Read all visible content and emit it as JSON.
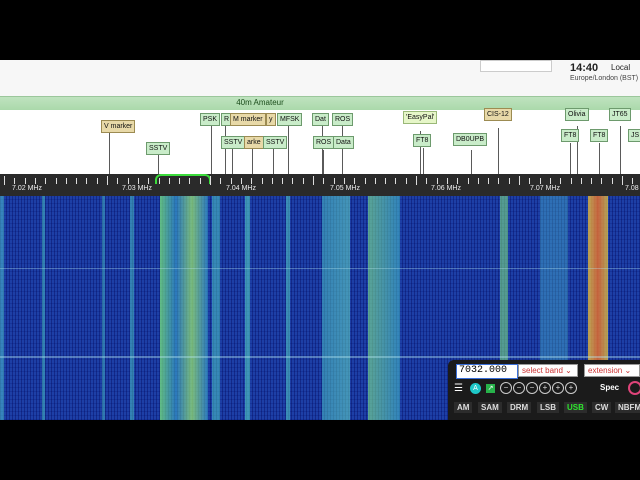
{
  "header": {
    "time": "14:40",
    "time_zone_label": "Local",
    "time_zone": "Europe/London (BST)"
  },
  "band": {
    "name": "40m Amateur"
  },
  "markers": [
    {
      "label": "V marker",
      "style": "tan"
    },
    {
      "label": "SSTV",
      "style": "green"
    },
    {
      "label": "PSK",
      "style": "green"
    },
    {
      "label": "R",
      "style": "green"
    },
    {
      "label": "M marker",
      "style": "tan"
    },
    {
      "label": "y",
      "style": "tan"
    },
    {
      "label": "SSTV",
      "style": "green"
    },
    {
      "label": "arke",
      "style": "tan"
    },
    {
      "label": "SSTV",
      "style": "green"
    },
    {
      "label": "MFSK",
      "style": "green"
    },
    {
      "label": "Dat",
      "style": "green"
    },
    {
      "label": "ROS",
      "style": "green"
    },
    {
      "label": "ROS",
      "style": "green"
    },
    {
      "label": "Data",
      "style": "green"
    },
    {
      "label": "'EasyPal'",
      "style": "lightgreen"
    },
    {
      "label": "FT8",
      "style": "green"
    },
    {
      "label": "DB0UPB",
      "style": "green"
    },
    {
      "label": "CIS-12",
      "style": "tan"
    },
    {
      "label": "Olivia",
      "style": "green"
    },
    {
      "label": "JT65",
      "style": "green"
    },
    {
      "label": "FT8",
      "style": "green"
    },
    {
      "label": "FT8",
      "style": "green"
    },
    {
      "label": "JS",
      "style": "green"
    }
  ],
  "scale": {
    "labels": [
      "7.02 MHz",
      "7.03 MHz",
      "7.04 MHz",
      "7.05 MHz",
      "7.06 MHz",
      "7.07 MHz",
      "7.08"
    ]
  },
  "controls": {
    "frequency": "7032.000",
    "band_select": "select band",
    "extension_select": "extension",
    "spec_label": "Spec",
    "a_label": "A",
    "step_buttons": [
      "−",
      "−",
      "−",
      "+",
      "+",
      "+"
    ],
    "modes": [
      "AM",
      "SAM",
      "DRM",
      "LSB",
      "USB",
      "CW",
      "NBFM"
    ],
    "active_mode": "USB"
  },
  "colors": {
    "waterfall_bg": "#1d3fa6",
    "passband": "#3bdc3b",
    "active_mode": "#2ee62e",
    "marker_green": "#c9ecc9",
    "marker_tan": "#e8d9a8"
  }
}
